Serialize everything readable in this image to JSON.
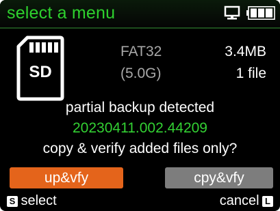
{
  "header": {
    "title": "select a menu",
    "pc_icon": "pc-connection-icon",
    "battery_icon": "battery-full-icon"
  },
  "card": {
    "icon": "sd-card-icon",
    "icon_label": "SD",
    "filesystem": "FAT32",
    "capacity": "(5.0G)",
    "size": "3.4MB",
    "files": "1 file"
  },
  "message": {
    "line1": "partial backup detected",
    "session": "20230411.002.44209",
    "line2": "copy & verify added files only?"
  },
  "buttons": {
    "primary": "up&vfy",
    "secondary": "cpy&vfy"
  },
  "footer": {
    "left_key": "S",
    "left_label": "select",
    "right_label": "cancel",
    "right_key": "L"
  },
  "colors": {
    "title_green": "#2ed12e",
    "session_green": "#33d133",
    "primary_orange": "#e4641b",
    "secondary_gray": "#7d7d7d"
  }
}
